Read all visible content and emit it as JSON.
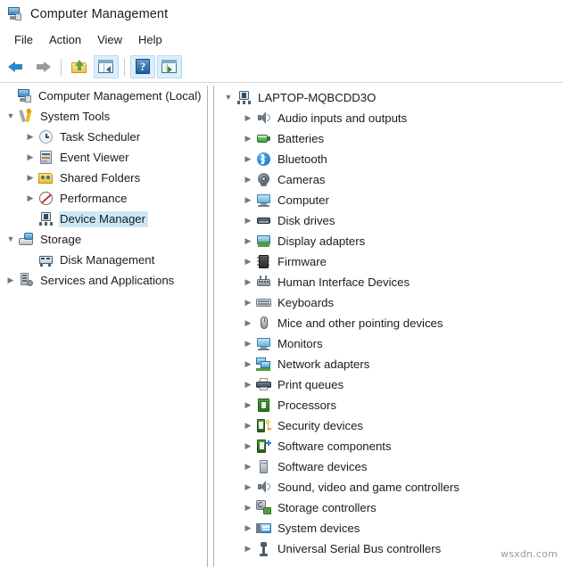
{
  "window": {
    "title": "Computer Management",
    "app_icon": "computer-management-icon"
  },
  "menubar": {
    "items": [
      {
        "label": "File",
        "name": "menu-file"
      },
      {
        "label": "Action",
        "name": "menu-action"
      },
      {
        "label": "View",
        "name": "menu-view"
      },
      {
        "label": "Help",
        "name": "menu-help"
      }
    ]
  },
  "toolbar": {
    "buttons": [
      {
        "name": "back-button",
        "icon": "back-arrow-icon",
        "tooltip": "Back"
      },
      {
        "name": "forward-button",
        "icon": "forward-arrow-icon",
        "tooltip": "Forward"
      },
      {
        "name": "up-one-level-button",
        "icon": "folder-up-icon",
        "tooltip": "Up One Level"
      },
      {
        "name": "show-hide-console-tree-button",
        "icon": "console-tree-icon",
        "tooltip": "Show/Hide Console Tree"
      },
      {
        "name": "help-button",
        "icon": "help-icon",
        "tooltip": "Help"
      },
      {
        "name": "show-hide-action-pane-button",
        "icon": "action-pane-icon",
        "tooltip": "Show/Hide Action Pane"
      }
    ]
  },
  "console_tree": {
    "root": {
      "label": "Computer Management (Local)",
      "icon": "computer-management-icon",
      "expander": "none",
      "indent": 0,
      "selected": false
    },
    "items": [
      {
        "label": "System Tools",
        "icon": "system-tools-icon",
        "expander": "expanded",
        "indent": 1,
        "selected": false
      },
      {
        "label": "Task Scheduler",
        "icon": "task-scheduler-icon",
        "expander": "collapsed",
        "indent": 2,
        "selected": false
      },
      {
        "label": "Event Viewer",
        "icon": "event-viewer-icon",
        "expander": "collapsed",
        "indent": 2,
        "selected": false
      },
      {
        "label": "Shared Folders",
        "icon": "shared-folders-icon",
        "expander": "collapsed",
        "indent": 2,
        "selected": false
      },
      {
        "label": "Performance",
        "icon": "performance-icon",
        "expander": "collapsed",
        "indent": 2,
        "selected": false
      },
      {
        "label": "Device Manager",
        "icon": "device-manager-icon",
        "expander": "none",
        "indent": 2,
        "selected": true
      },
      {
        "label": "Storage",
        "icon": "storage-icon",
        "expander": "expanded",
        "indent": 1,
        "selected": false
      },
      {
        "label": "Disk Management",
        "icon": "disk-management-icon",
        "expander": "none",
        "indent": 2,
        "selected": false
      },
      {
        "label": "Services and Applications",
        "icon": "services-applications-icon",
        "expander": "collapsed",
        "indent": 1,
        "selected": false
      }
    ]
  },
  "device_tree": {
    "root": {
      "label": "LAPTOP-MQBCDD3O",
      "icon": "computer-node-icon",
      "expander": "expanded",
      "indent": 0
    },
    "items": [
      {
        "label": "Audio inputs and outputs",
        "icon": "speaker-icon",
        "expander": "collapsed"
      },
      {
        "label": "Batteries",
        "icon": "battery-icon",
        "expander": "collapsed"
      },
      {
        "label": "Bluetooth",
        "icon": "bluetooth-icon",
        "expander": "collapsed"
      },
      {
        "label": "Cameras",
        "icon": "camera-icon",
        "expander": "collapsed"
      },
      {
        "label": "Computer",
        "icon": "monitor-icon",
        "expander": "collapsed"
      },
      {
        "label": "Disk drives",
        "icon": "hard-disk-icon",
        "expander": "collapsed"
      },
      {
        "label": "Display adapters",
        "icon": "display-adapter-icon",
        "expander": "collapsed"
      },
      {
        "label": "Firmware",
        "icon": "firmware-chip-icon",
        "expander": "collapsed"
      },
      {
        "label": "Human Interface Devices",
        "icon": "hid-icon",
        "expander": "collapsed"
      },
      {
        "label": "Keyboards",
        "icon": "keyboard-icon",
        "expander": "collapsed"
      },
      {
        "label": "Mice and other pointing devices",
        "icon": "mouse-icon",
        "expander": "collapsed"
      },
      {
        "label": "Monitors",
        "icon": "monitor-icon",
        "expander": "collapsed"
      },
      {
        "label": "Network adapters",
        "icon": "network-adapter-icon",
        "expander": "collapsed"
      },
      {
        "label": "Print queues",
        "icon": "printer-icon",
        "expander": "collapsed"
      },
      {
        "label": "Processors",
        "icon": "processor-icon",
        "expander": "collapsed"
      },
      {
        "label": "Security devices",
        "icon": "security-device-icon",
        "expander": "collapsed"
      },
      {
        "label": "Software components",
        "icon": "software-component-icon",
        "expander": "collapsed"
      },
      {
        "label": "Software devices",
        "icon": "software-device-icon",
        "expander": "collapsed"
      },
      {
        "label": "Sound, video and game controllers",
        "icon": "speaker-icon",
        "expander": "collapsed"
      },
      {
        "label": "Storage controllers",
        "icon": "storage-controller-icon",
        "expander": "collapsed"
      },
      {
        "label": "System devices",
        "icon": "system-device-icon",
        "expander": "collapsed"
      },
      {
        "label": "Universal Serial Bus controllers",
        "icon": "usb-icon",
        "expander": "collapsed"
      }
    ]
  },
  "watermark": {
    "text": "wsxdn.com"
  },
  "colors": {
    "selection": "#cce8f7",
    "window_bg": "#ffffff",
    "border": "#b2b2b2",
    "text": "#1b1b1b",
    "chevron": "#767676"
  }
}
